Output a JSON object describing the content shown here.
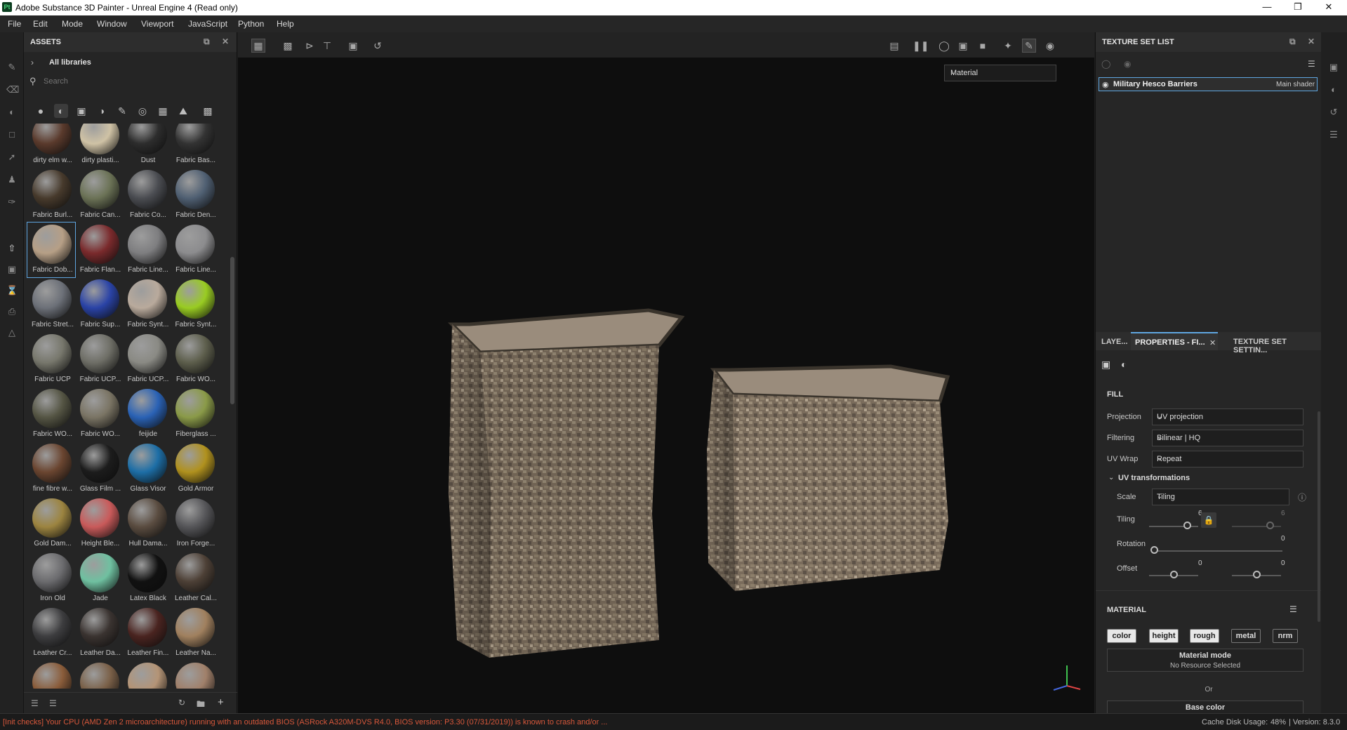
{
  "window": {
    "title": "Adobe Substance 3D Painter - Unreal Engine 4 (Read only)",
    "app_icon": "Pt"
  },
  "menu": [
    "File",
    "Edit",
    "Mode",
    "Window",
    "Viewport",
    "JavaScript",
    "Python",
    "Help"
  ],
  "assets": {
    "title": "ASSETS",
    "breadcrumb": "All libraries",
    "search_placeholder": "Search",
    "filters": [
      "material-sphere-icon",
      "smart-material-icon",
      "mask-icon",
      "filter-icon",
      "brush-icon",
      "alpha-icon",
      "texture-icon",
      "environment-icon",
      "grid-view-icon"
    ],
    "items": [
      {
        "label": "dirty elm w...",
        "color": "#5a3a2c"
      },
      {
        "label": "dirty plasti...",
        "color": "#cfc2a5"
      },
      {
        "label": "Dust",
        "color": "#2d2d2d"
      },
      {
        "label": "Fabric Bas...",
        "color": "#333333"
      },
      {
        "label": "Fabric Burl...",
        "color": "#473a2c"
      },
      {
        "label": "Fabric Can...",
        "color": "#6b7256"
      },
      {
        "label": "Fabric Co...",
        "color": "#4a4c51"
      },
      {
        "label": "Fabric Den...",
        "color": "#4f5f72"
      },
      {
        "label": "Fabric Dob...",
        "color": "#b69f86"
      },
      {
        "label": "Fabric Flan...",
        "color": "#7a2a2c"
      },
      {
        "label": "Fabric Line...",
        "color": "#7e7e80"
      },
      {
        "label": "Fabric Line...",
        "color": "#8c8c8e"
      },
      {
        "label": "Fabric Stret...",
        "color": "#6c7078"
      },
      {
        "label": "Fabric Sup...",
        "color": "#2a43a6"
      },
      {
        "label": "Fabric Synt...",
        "color": "#b9aa9c"
      },
      {
        "label": "Fabric Synt...",
        "color": "#99cc22"
      },
      {
        "label": "Fabric UCP",
        "color": "#77776c"
      },
      {
        "label": "Fabric UCP...",
        "color": "#6e6e66"
      },
      {
        "label": "Fabric UCP...",
        "color": "#8a8a84"
      },
      {
        "label": "Fabric WO...",
        "color": "#5d5e4c"
      },
      {
        "label": "Fabric WO...",
        "color": "#555544"
      },
      {
        "label": "Fabric WO...",
        "color": "#7a7464"
      },
      {
        "label": "feijide",
        "color": "#2a62b5"
      },
      {
        "label": "Fiberglass ...",
        "color": "#8a9a48"
      },
      {
        "label": "fine fibre w...",
        "color": "#6a4530"
      },
      {
        "label": "Glass Film ...",
        "color": "#1c1c1c"
      },
      {
        "label": "Glass Visor",
        "color": "#1d6ea6"
      },
      {
        "label": "Gold Armor",
        "color": "#b0911e"
      },
      {
        "label": "Gold Dam...",
        "color": "#9c8440"
      },
      {
        "label": "Height Ble...",
        "color": "#c95a5a"
      },
      {
        "label": "Hull Dama...",
        "color": "#5a4c40"
      },
      {
        "label": "Iron Forge...",
        "color": "#555558"
      },
      {
        "label": "Iron Old",
        "color": "#6b6b6e"
      },
      {
        "label": "Jade",
        "color": "#6fc0a0"
      },
      {
        "label": "Latex Black",
        "color": "#111111"
      },
      {
        "label": "Leather Cal...",
        "color": "#4d4036"
      },
      {
        "label": "Leather Cr...",
        "color": "#3d3d3f"
      },
      {
        "label": "Leather Da...",
        "color": "#3a3330"
      },
      {
        "label": "Leather Fin...",
        "color": "#4a2420"
      },
      {
        "label": "Leather Na...",
        "color": "#a0805e"
      },
      {
        "label": "",
        "color": "#8a5c3a"
      },
      {
        "label": "",
        "color": "#7a6048"
      },
      {
        "label": "",
        "color": "#b49476"
      },
      {
        "label": "",
        "color": "#a0806a"
      }
    ],
    "selected_index": 8
  },
  "viewport": {
    "material_mode": "Material",
    "toolbar_icons": [
      "layers-view-icon",
      "grid-icon",
      "mirror-x-icon",
      "mirror-y-icon",
      "frame-icon",
      "reset-camera-icon",
      "hide-icon",
      "pause-icon",
      "display-icon",
      "box-icon",
      "camera-icon",
      "effects-icon",
      "paint-icon",
      "screenshot-icon"
    ]
  },
  "texture_set_list": {
    "title": "TEXTURE SET LIST",
    "set_name": "Military Hesco Barriers",
    "shader": "Main shader"
  },
  "properties": {
    "tabs": [
      "LAYE...",
      "PROPERTIES - FI...",
      "TEXTURE SET SETTIN..."
    ],
    "section": "FILL",
    "projection": {
      "label": "Projection",
      "value": "UV projection"
    },
    "filtering": {
      "label": "Filtering",
      "value": "Bilinear | HQ"
    },
    "uvwrap": {
      "label": "UV Wrap",
      "value": "Repeat"
    },
    "uvtrans": "UV transformations",
    "scale": {
      "label": "Scale",
      "value": "Tiling"
    },
    "tiling": {
      "label": "Tiling",
      "u": "6",
      "v": "6",
      "u_ratio": 0.75,
      "v_ratio": 0.75
    },
    "rotation": {
      "label": "Rotation",
      "value": "0"
    },
    "offset": {
      "label": "Offset",
      "u": "0",
      "v": "0"
    },
    "material": {
      "title": "MATERIAL",
      "channels": [
        "color",
        "height",
        "rough",
        "metal",
        "nrm"
      ],
      "active": [
        "color",
        "height",
        "rough"
      ],
      "mode_title": "Material mode",
      "mode_value": "No Resource Selected",
      "or": "Or",
      "base_color": "Base color"
    }
  },
  "status": {
    "message": "[Init checks] Your CPU (AMD Zen 2 microarchitecture) running with an outdated BIOS (ASRock A320M-DVS R4.0, BIOS version: P3.30 (07/31/2019)) is known to crash and/or ...",
    "cache": "Cache Disk Usage:",
    "cache_pct": "48%",
    "version": "| Version: 8.3.0"
  },
  "colors": {
    "accent": "#5fa6e0",
    "status_error": "#d9583b"
  }
}
